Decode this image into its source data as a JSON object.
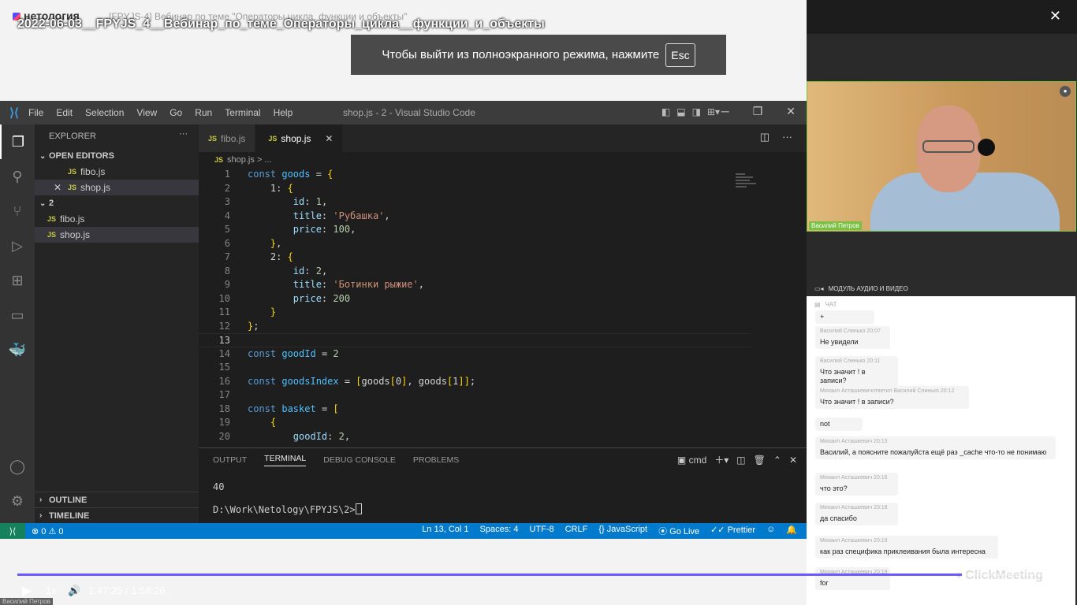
{
  "webinar": {
    "brand": "нетология",
    "subtitle": "[FPYJS-4] Вебинар по теме \"Операторы цикла, функции и объекты\"",
    "video_title": "2022-06-03__FPYJS_4__Вебинар_по_теме_Операторы_цикла__функции_и_объекты",
    "fullscreen_notice": "Чтобы выйти из полноэкранного режима, нажмите",
    "esc_key": "Esc"
  },
  "vscode": {
    "menu": [
      "File",
      "Edit",
      "Selection",
      "View",
      "Go",
      "Run",
      "Terminal",
      "Help"
    ],
    "window_title": "shop.js - 2 - Visual Studio Code",
    "explorer": {
      "title": "EXPLORER",
      "open_editors_label": "OPEN EDITORS",
      "open_editors": [
        "fibo.js",
        "shop.js"
      ],
      "folder_name": "2",
      "files": [
        "fibo.js",
        "shop.js"
      ],
      "outline_label": "OUTLINE",
      "timeline_label": "TIMELINE"
    },
    "tabs": [
      {
        "label": "fibo.js",
        "active": false
      },
      {
        "label": "shop.js",
        "active": true
      }
    ],
    "breadcrumb": "shop.js > ...",
    "code_lines": [
      {
        "n": "1",
        "text": "const goods = {"
      },
      {
        "n": "2",
        "text": "    1: {"
      },
      {
        "n": "3",
        "text": "        id: 1,"
      },
      {
        "n": "4",
        "text": "        title: 'Рубашка',"
      },
      {
        "n": "5",
        "text": "        price: 100,"
      },
      {
        "n": "6",
        "text": "    },"
      },
      {
        "n": "7",
        "text": "    2: {"
      },
      {
        "n": "8",
        "text": "        id: 2,"
      },
      {
        "n": "9",
        "text": "        title: 'Ботинки рыжие',"
      },
      {
        "n": "10",
        "text": "        price: 200"
      },
      {
        "n": "11",
        "text": "    }"
      },
      {
        "n": "12",
        "text": "};"
      },
      {
        "n": "13",
        "text": ""
      },
      {
        "n": "14",
        "text": "const goodId = 2"
      },
      {
        "n": "15",
        "text": ""
      },
      {
        "n": "16",
        "text": "const goodsIndex = [goods[0], goods[1]];"
      },
      {
        "n": "17",
        "text": ""
      },
      {
        "n": "18",
        "text": "const basket = ["
      },
      {
        "n": "19",
        "text": "    {"
      },
      {
        "n": "20",
        "text": "        goodId: 2,"
      }
    ],
    "current_line": "13",
    "panel": {
      "tabs": [
        "OUTPUT",
        "TERMINAL",
        "DEBUG CONSOLE",
        "PROBLEMS"
      ],
      "active_tab": "TERMINAL",
      "shell": "cmd",
      "output_line": "40",
      "prompt": "D:\\Work\\Netology\\FPYJS\\2>"
    },
    "statusbar": {
      "problems": "⊗ 0 ⚠ 0",
      "position": "Ln 13, Col 1",
      "spaces": "Spaces: 4",
      "encoding": "UTF-8",
      "eol": "CRLF",
      "language": "{} JavaScript",
      "golive": "Go Live",
      "prettier": "Prettier"
    }
  },
  "webcam": {
    "name": "Василий Петров"
  },
  "av_module_label": "МОДУЛЬ АУДИО И ВИДЕО",
  "chat": {
    "title": "ЧАТ",
    "messages": [
      {
        "meta": "",
        "text": "+"
      },
      {
        "meta": "Василий Слинько  20:07",
        "text": "Не увидели"
      },
      {
        "meta": "Василий Слинько  20:11",
        "text": "Что значит ! в записи?"
      },
      {
        "meta": "Михаил Асташкевичответил Василий Слинько  20:12",
        "text": "Что значит ! в записи?"
      },
      {
        "meta": "",
        "text": "not"
      },
      {
        "meta": "Михаил Асташкевич  20:15",
        "text": "Василий, а поясните пожалуйста ещё раз _cache что-то не понимаю"
      },
      {
        "meta": "Михаил Асташкевич  20:16",
        "text": "что это?"
      },
      {
        "meta": "Михаил Асташкевич  20:18",
        "text": "да спасибо"
      },
      {
        "meta": "Михаил Асташкевич  20:19",
        "text": "как раз специфика приклеивания была интересна"
      },
      {
        "meta": "Михаил Асташкевич  20:19",
        "text": "for"
      }
    ]
  },
  "watermark": "ClickMeeting",
  "player": {
    "speed": "1x",
    "time": "1:47:25 / 1:58:26",
    "progress": 0.907
  },
  "corner_name": "Василий Петров",
  "colors": {
    "keyword": "#569cd6",
    "variable": "#4fc1ff",
    "string": "#ce9178",
    "number": "#b5cea8",
    "property": "#9cdcfe",
    "bracket": "#ffd700",
    "statusbar": "#007acc",
    "progress": "#6b5bff",
    "webcam_border": "#7ac143"
  }
}
